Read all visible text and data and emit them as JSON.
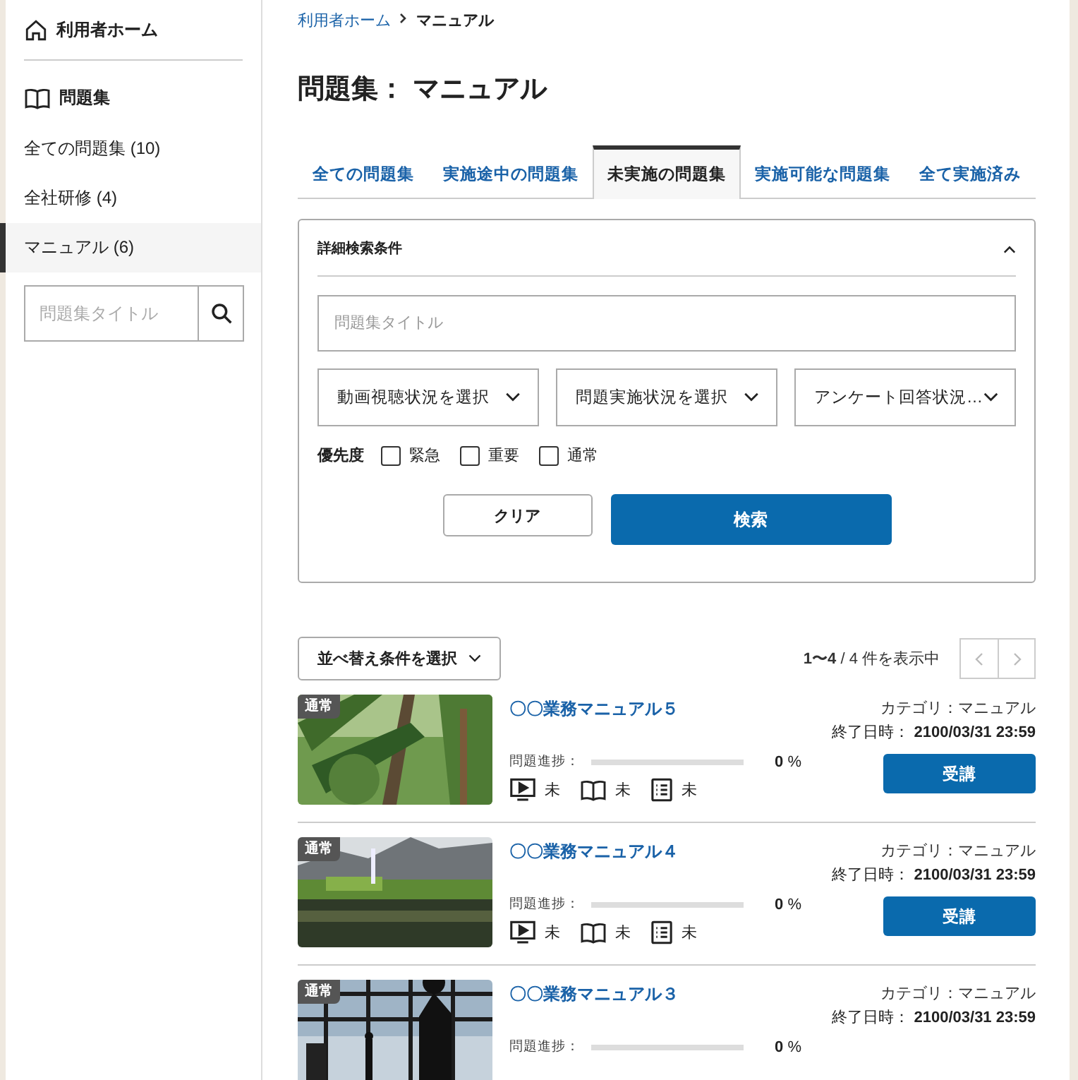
{
  "sidebar": {
    "home": "利用者ホーム",
    "section": "問題集",
    "items": [
      {
        "label": "全ての問題集 (10)",
        "selected": false
      },
      {
        "label": "全社研修 (4)",
        "selected": false
      },
      {
        "label": "マニュアル (6)",
        "selected": true
      }
    ],
    "search": {
      "placeholder": "問題集タイトル"
    }
  },
  "breadcrumb": [
    {
      "label": "利用者ホーム",
      "kind": "link"
    },
    {
      "label": "マニュアル",
      "kind": "current"
    }
  ],
  "page_title": "問題集： マニュアル",
  "tabs": [
    {
      "label": "全ての問題集",
      "selected": false
    },
    {
      "label": "実施途中の問題集",
      "selected": false
    },
    {
      "label": "未実施の問題集",
      "selected": true
    },
    {
      "label": "実施可能な問題集",
      "selected": false
    },
    {
      "label": "全て実施済み",
      "selected": false
    }
  ],
  "search_panel": {
    "title": "詳細検索条件",
    "expanded": true,
    "title_field": {
      "placeholder": "問題集タイトル"
    },
    "selects": [
      "動画視聴状況を選択",
      "問題実施状況を選択",
      "アンケート回答状況…"
    ],
    "priority_label": "優先度",
    "priorities": [
      {
        "label": "緊急",
        "checked": false
      },
      {
        "label": "重要",
        "checked": false
      },
      {
        "label": "通常",
        "checked": false
      }
    ],
    "clear_button": "クリア",
    "search_button": "検索"
  },
  "sort": {
    "label": "並べ替え条件を選択"
  },
  "result_count": "**1〜4** / 4 件を表示中",
  "items": [
    {
      "badge": "通常",
      "title": "〇〇業務マニュアル５",
      "category": "カテゴリ：マニュアル",
      "end_label": "終了日時：",
      "end_date": "2100/03/31 23:59",
      "progress_label": "問題進捗：",
      "level": 0,
      "percent": "**0** %",
      "statuses": [
        {
          "kind": "video",
          "label": "未"
        },
        {
          "kind": "book",
          "label": "未"
        },
        {
          "kind": "list",
          "label": "未"
        }
      ],
      "button": "受講"
    },
    {
      "badge": "通常",
      "title": "〇〇業務マニュアル４",
      "category": "カテゴリ：マニュアル",
      "end_label": "終了日時：",
      "end_date": "2100/03/31 23:59",
      "progress_label": "問題進捗：",
      "level": 0,
      "percent": "**0** %",
      "statuses": [
        {
          "kind": "video",
          "label": "未"
        },
        {
          "kind": "book",
          "label": "未"
        },
        {
          "kind": "list",
          "label": "未"
        }
      ],
      "button": "受講"
    },
    {
      "badge": "通常",
      "title": "〇〇業務マニュアル３",
      "category": "カテゴリ：マニュアル",
      "end_label": "終了日時：",
      "end_date": "2100/03/31 23:59",
      "progress_label": "問題進捗：",
      "level": 0,
      "percent": "**0** %"
    }
  ]
}
